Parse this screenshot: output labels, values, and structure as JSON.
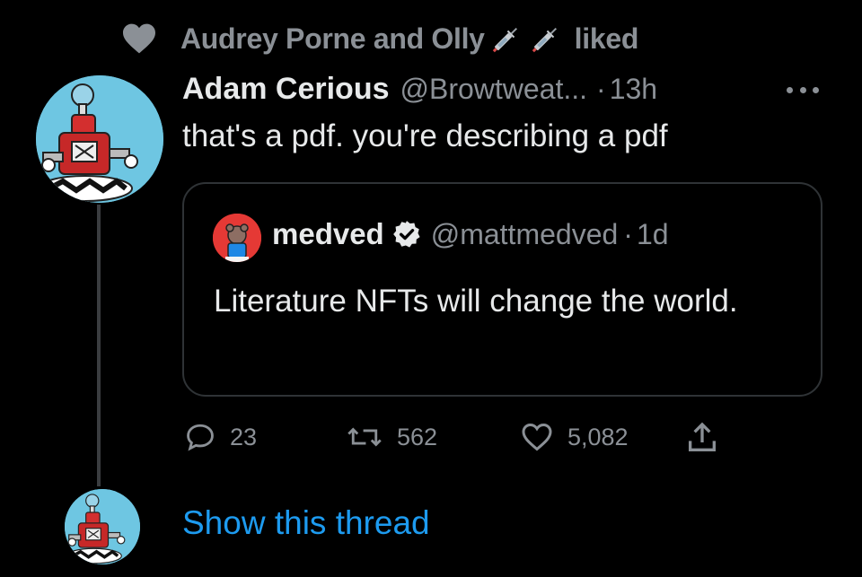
{
  "social_context": {
    "names": "Audrey Porne and Olly",
    "action": "liked",
    "icon": "heart-icon",
    "emoji": [
      "syringe-icon",
      "syringe-icon"
    ]
  },
  "tweet": {
    "display_name": "Adam Cerious",
    "handle": "@Browtweat...",
    "separator": "·",
    "time": "13h",
    "text": "that's a pdf. you're describing a pdf",
    "more_icon": "more-icon"
  },
  "quote": {
    "display_name": "medved",
    "verified": true,
    "handle": "@mattmedved",
    "separator": "·",
    "time": "1d",
    "text": "Literature NFTs will change the world."
  },
  "actions": {
    "replies": "23",
    "retweets": "562",
    "likes": "5,082"
  },
  "show_thread": "Show this thread",
  "colors": {
    "background": "#000000",
    "primary_text": "#e7e9ea",
    "secondary_text": "#8b9096",
    "link": "#1d9bf0",
    "border": "#2f3336"
  }
}
